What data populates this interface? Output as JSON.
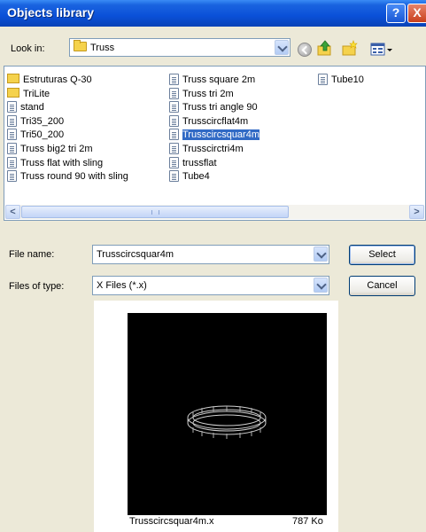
{
  "window": {
    "title": "Objects library",
    "help_glyph": "?",
    "close_glyph": "X"
  },
  "lookin": {
    "label": "Look in:",
    "value": "Truss"
  },
  "toolbar": {
    "icons": [
      "back-icon",
      "up-folder-icon",
      "new-folder-icon",
      "view-menu-icon"
    ]
  },
  "files": [
    {
      "name": "Estruturas Q-30",
      "type": "folder",
      "col": 0,
      "row": 0
    },
    {
      "name": "TriLite",
      "type": "folder",
      "col": 0,
      "row": 1
    },
    {
      "name": "stand",
      "type": "file",
      "col": 0,
      "row": 2
    },
    {
      "name": "Tri35_200",
      "type": "file",
      "col": 0,
      "row": 3
    },
    {
      "name": "Tri50_200",
      "type": "file",
      "col": 0,
      "row": 4
    },
    {
      "name": "Truss big2 tri 2m",
      "type": "file",
      "col": 0,
      "row": 5
    },
    {
      "name": "Truss flat with sling",
      "type": "file",
      "col": 0,
      "row": 6
    },
    {
      "name": "Truss round 90 with sling",
      "type": "file",
      "col": 0,
      "row": 7
    },
    {
      "name": "Truss square 2m",
      "type": "file",
      "col": 1,
      "row": 0
    },
    {
      "name": "Truss tri 2m",
      "type": "file",
      "col": 1,
      "row": 1
    },
    {
      "name": "Truss tri angle 90",
      "type": "file",
      "col": 1,
      "row": 2
    },
    {
      "name": "Trusscircflat4m",
      "type": "file",
      "col": 1,
      "row": 3
    },
    {
      "name": "Trusscircsquar4m",
      "type": "file",
      "col": 1,
      "row": 4,
      "selected": true
    },
    {
      "name": "Trusscirctri4m",
      "type": "file",
      "col": 1,
      "row": 5
    },
    {
      "name": "trussflat",
      "type": "file",
      "col": 1,
      "row": 6
    },
    {
      "name": "Tube4",
      "type": "file",
      "col": 1,
      "row": 7
    },
    {
      "name": "Tube10",
      "type": "file",
      "col": 2,
      "row": 0
    }
  ],
  "filename": {
    "label": "File name:",
    "value": "Trusscircsquar4m"
  },
  "filetype": {
    "label": "Files of type:",
    "value": "X Files (*.x)"
  },
  "buttons": {
    "select": "Select",
    "cancel": "Cancel"
  },
  "preview": {
    "filename": "Trusscircsquar4m.x",
    "size": "787 Ko"
  }
}
